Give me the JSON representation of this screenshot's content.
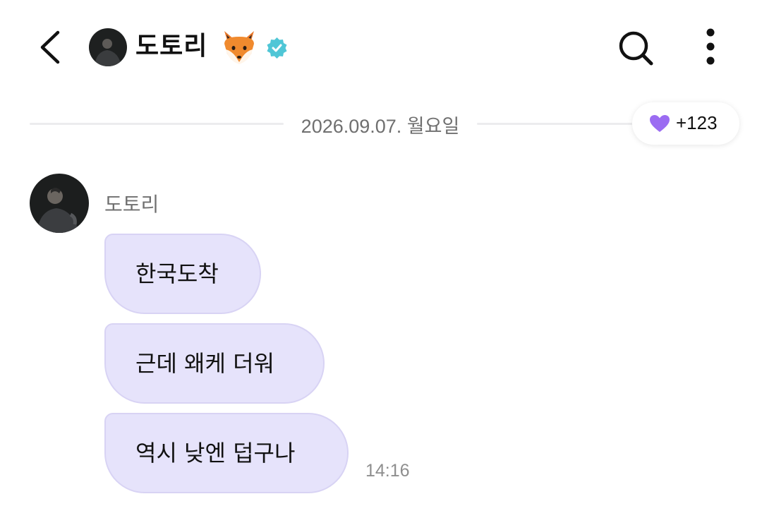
{
  "header": {
    "title": "도토리",
    "back_icon": "chevron-left-icon",
    "title_emoji_icon": "fox-face-icon",
    "verified_icon": "verified-badge-icon",
    "search_icon": "search-icon",
    "more_icon": "more-vertical-icon"
  },
  "date_divider": {
    "label": "2026.09.07. 월요일"
  },
  "reaction": {
    "icon": "purple-heart-icon",
    "count": "+123"
  },
  "sender": {
    "name": "도토리",
    "avatar_icon": "profile-photo"
  },
  "messages": [
    {
      "text": "한국도착"
    },
    {
      "text": "근데 왜케 더워"
    },
    {
      "text": "역시 낮엔 덥구나"
    }
  ],
  "last_message_time": "14:16",
  "colors": {
    "bubble_bg": "#e6e3fb",
    "bubble_border": "#d8d3f4",
    "verified": "#4fc6d6",
    "heart": "#9b6cf2"
  }
}
